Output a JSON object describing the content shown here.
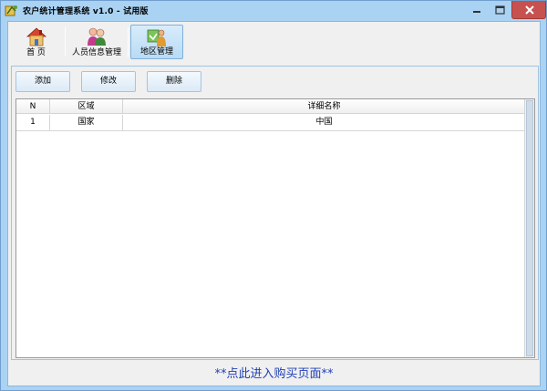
{
  "window": {
    "title": "农户统计管理系统 v1.0 - 试用版"
  },
  "toolbar": {
    "items": [
      {
        "label": "首  页",
        "icon": "house-icon"
      },
      {
        "label": "人员信息管理",
        "icon": "people-icon"
      },
      {
        "label": "地区管理",
        "icon": "region-icon"
      }
    ]
  },
  "actions": {
    "add_label": "添加",
    "edit_label": "修改",
    "delete_label": "删除"
  },
  "table": {
    "columns": [
      "N",
      "区域",
      "详细名称"
    ],
    "rows": [
      [
        "1",
        "国家",
        "中国"
      ]
    ]
  },
  "footer": {
    "link_text": "**点此进入购买页面**"
  },
  "colors": {
    "window_border": "#a9d2f3",
    "close_button": "#c7514f",
    "footer_link": "#1f3fb3"
  }
}
